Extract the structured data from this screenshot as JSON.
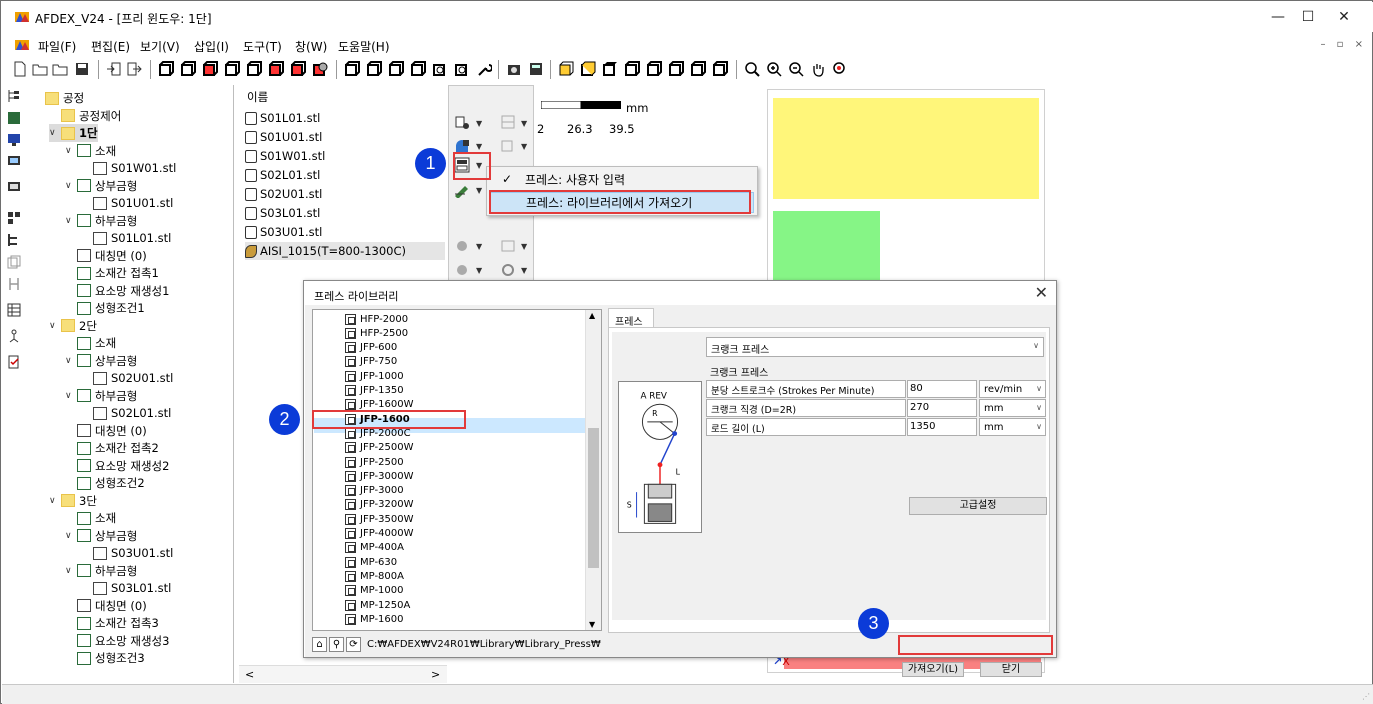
{
  "window": {
    "title": "AFDEX_V24 - [프리 윈도우: 1단]",
    "minimize": "—",
    "maximize": "☐",
    "close": "✕"
  },
  "menu": {
    "items": [
      "파일(F)",
      "편집(E)",
      "보기(V)",
      "삽입(I)",
      "도구(T)",
      "창(W)",
      "도움말(H)"
    ],
    "mdi_controls": "– ▫ ×"
  },
  "tree": {
    "nodes": [
      {
        "label": "공정",
        "level": 0,
        "icon": "folder-icon",
        "caret": ""
      },
      {
        "label": "공정제어",
        "level": 1,
        "icon": "folder-icon",
        "caret": ""
      },
      {
        "label": "1단",
        "level": 1,
        "icon": "folder-icon",
        "caret": "∨",
        "selected": true
      },
      {
        "label": "소재",
        "level": 2,
        "icon": "material-icon",
        "caret": "∨"
      },
      {
        "label": "S01W01.stl",
        "level": 3,
        "icon": "stl-icon",
        "caret": ""
      },
      {
        "label": "상부금형",
        "level": 2,
        "icon": "upper-die-icon",
        "caret": "∨"
      },
      {
        "label": "S01U01.stl",
        "level": 3,
        "icon": "stl-icon",
        "caret": ""
      },
      {
        "label": "하부금형",
        "level": 2,
        "icon": "lower-die-icon",
        "caret": "∨"
      },
      {
        "label": "S01L01.stl",
        "level": 3,
        "icon": "stl-icon",
        "caret": ""
      },
      {
        "label": "대칭면 (0)",
        "level": 2,
        "icon": "symmetry-icon",
        "caret": ""
      },
      {
        "label": "소재간 접촉1",
        "level": 2,
        "icon": "contact-icon",
        "caret": ""
      },
      {
        "label": "요소망 재생성1",
        "level": 2,
        "icon": "remesh-icon",
        "caret": ""
      },
      {
        "label": "성형조건1",
        "level": 2,
        "icon": "condition-icon",
        "caret": ""
      },
      {
        "label": "2단",
        "level": 1,
        "icon": "folder-icon",
        "caret": "∨"
      },
      {
        "label": "소재",
        "level": 2,
        "icon": "material-icon",
        "caret": ""
      },
      {
        "label": "상부금형",
        "level": 2,
        "icon": "upper-die-icon",
        "caret": "∨"
      },
      {
        "label": "S02U01.stl",
        "level": 3,
        "icon": "stl-icon",
        "caret": ""
      },
      {
        "label": "하부금형",
        "level": 2,
        "icon": "lower-die-icon",
        "caret": "∨"
      },
      {
        "label": "S02L01.stl",
        "level": 3,
        "icon": "stl-icon",
        "caret": ""
      },
      {
        "label": "대칭면 (0)",
        "level": 2,
        "icon": "symmetry-icon",
        "caret": ""
      },
      {
        "label": "소재간 접촉2",
        "level": 2,
        "icon": "contact-icon",
        "caret": ""
      },
      {
        "label": "요소망 재생성2",
        "level": 2,
        "icon": "remesh-icon",
        "caret": ""
      },
      {
        "label": "성형조건2",
        "level": 2,
        "icon": "condition-icon",
        "caret": ""
      },
      {
        "label": "3단",
        "level": 1,
        "icon": "folder-icon",
        "caret": "∨"
      },
      {
        "label": "소재",
        "level": 2,
        "icon": "material-icon",
        "caret": ""
      },
      {
        "label": "상부금형",
        "level": 2,
        "icon": "upper-die-icon",
        "caret": "∨"
      },
      {
        "label": "S03U01.stl",
        "level": 3,
        "icon": "stl-icon",
        "caret": ""
      },
      {
        "label": "하부금형",
        "level": 2,
        "icon": "lower-die-icon",
        "caret": "∨"
      },
      {
        "label": "S03L01.stl",
        "level": 3,
        "icon": "stl-icon",
        "caret": ""
      },
      {
        "label": "대칭면 (0)",
        "level": 2,
        "icon": "symmetry-icon",
        "caret": ""
      },
      {
        "label": "소재간 접촉3",
        "level": 2,
        "icon": "contact-icon",
        "caret": ""
      },
      {
        "label": "요소망 재생성3",
        "level": 2,
        "icon": "remesh-icon",
        "caret": ""
      },
      {
        "label": "성형조건3",
        "level": 2,
        "icon": "condition-icon",
        "caret": ""
      }
    ]
  },
  "file_list": {
    "header": "이름",
    "files": [
      "S01L01.stl",
      "S01U01.stl",
      "S01W01.stl",
      "S02L01.stl",
      "S02U01.stl",
      "S03L01.stl",
      "S03U01.stl",
      "AISI_1015(T=800-1300C)"
    ],
    "scroll_left": "<",
    "scroll_right": ">"
  },
  "scale": {
    "unit": "mm",
    "ticks": [
      "2",
      "26.3",
      "39.5"
    ]
  },
  "context_menu": {
    "items": [
      {
        "label": "프레스: 사용자 입력",
        "checked": true
      },
      {
        "label": "프레스: 라이브러리에서 가져오기",
        "checked": false,
        "highlighted": true
      }
    ],
    "check_mark": "✓"
  },
  "dialog": {
    "title": "프레스 라이브러리",
    "close": "✕",
    "library_items": [
      "HFP-2000",
      "HFP-2500",
      "JFP-600",
      "JFP-750",
      "JFP-1000",
      "JFP-1350",
      "JFP-1600W",
      "JFP-1600",
      "JFP-2000C",
      "JFP-2500W",
      "JFP-2500",
      "JFP-3000W",
      "JFP-3000",
      "JFP-3200W",
      "JFP-3500W",
      "JFP-4000W",
      "MP-400A",
      "MP-630",
      "MP-800A",
      "MP-1000",
      "MP-1250A",
      "MP-1600"
    ],
    "selected_item": "JFP-1600",
    "path": "C:₩AFDEX₩V24R01₩Library₩Library_Press₩",
    "tab": "프레스",
    "press_type": "크랭크 프레스",
    "group_label": "크랭크 프레스",
    "figure_labels": {
      "rev": "A REV",
      "r": "R",
      "l": "L",
      "s": "S"
    },
    "params": [
      {
        "label": "분당 스트로크수 (Strokes Per Minute)",
        "value": "80",
        "unit": "rev/min"
      },
      {
        "label": "크랭크 직경 (D=2R)",
        "value": "270",
        "unit": "mm"
      },
      {
        "label": "로드 길이 (L)",
        "value": "1350",
        "unit": "mm"
      }
    ],
    "advanced_button": "고급설정",
    "import_button": "가져오기(L)",
    "close_button": "닫기"
  },
  "viewport": {
    "axis_label": "X"
  },
  "badges": [
    "1",
    "2",
    "3"
  ],
  "colors": {
    "highlight_red": "#e23a3a",
    "badge_blue": "#0b3bd8",
    "yellow_part": "#fff67a",
    "green_part": "#86f586",
    "coral_part": "#f98080"
  }
}
